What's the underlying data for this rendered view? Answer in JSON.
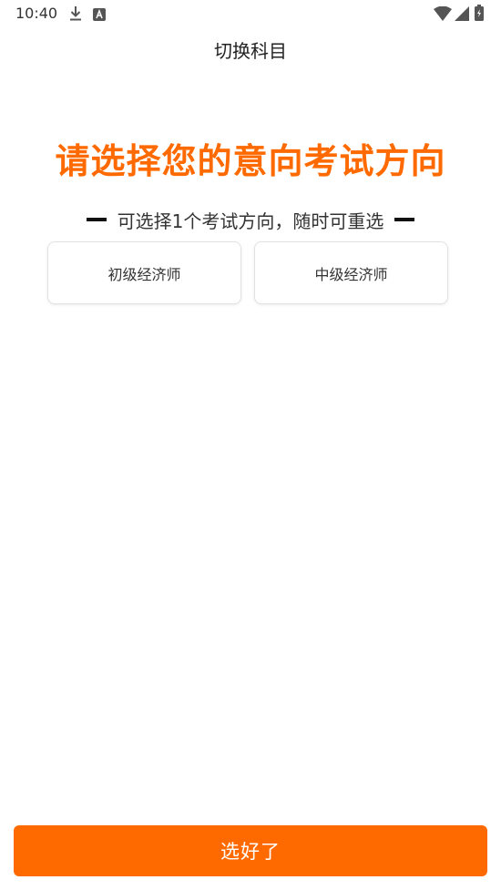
{
  "status_bar": {
    "time": "10:40",
    "icons": [
      "download-icon",
      "font-a-icon",
      "wifi-icon",
      "signal-icon",
      "battery-icon"
    ]
  },
  "header": {
    "title": "切换科目"
  },
  "main": {
    "headline": "请选择您的意向考试方向",
    "subtitle": "可选择1个考试方向，随时可重选",
    "options": [
      {
        "label": "初级经济师"
      },
      {
        "label": "中级经济师"
      }
    ]
  },
  "footer": {
    "confirm_label": "选好了"
  },
  "colors": {
    "accent": "#ff6a00",
    "text": "#222222",
    "card_border": "#e2e2e2"
  }
}
